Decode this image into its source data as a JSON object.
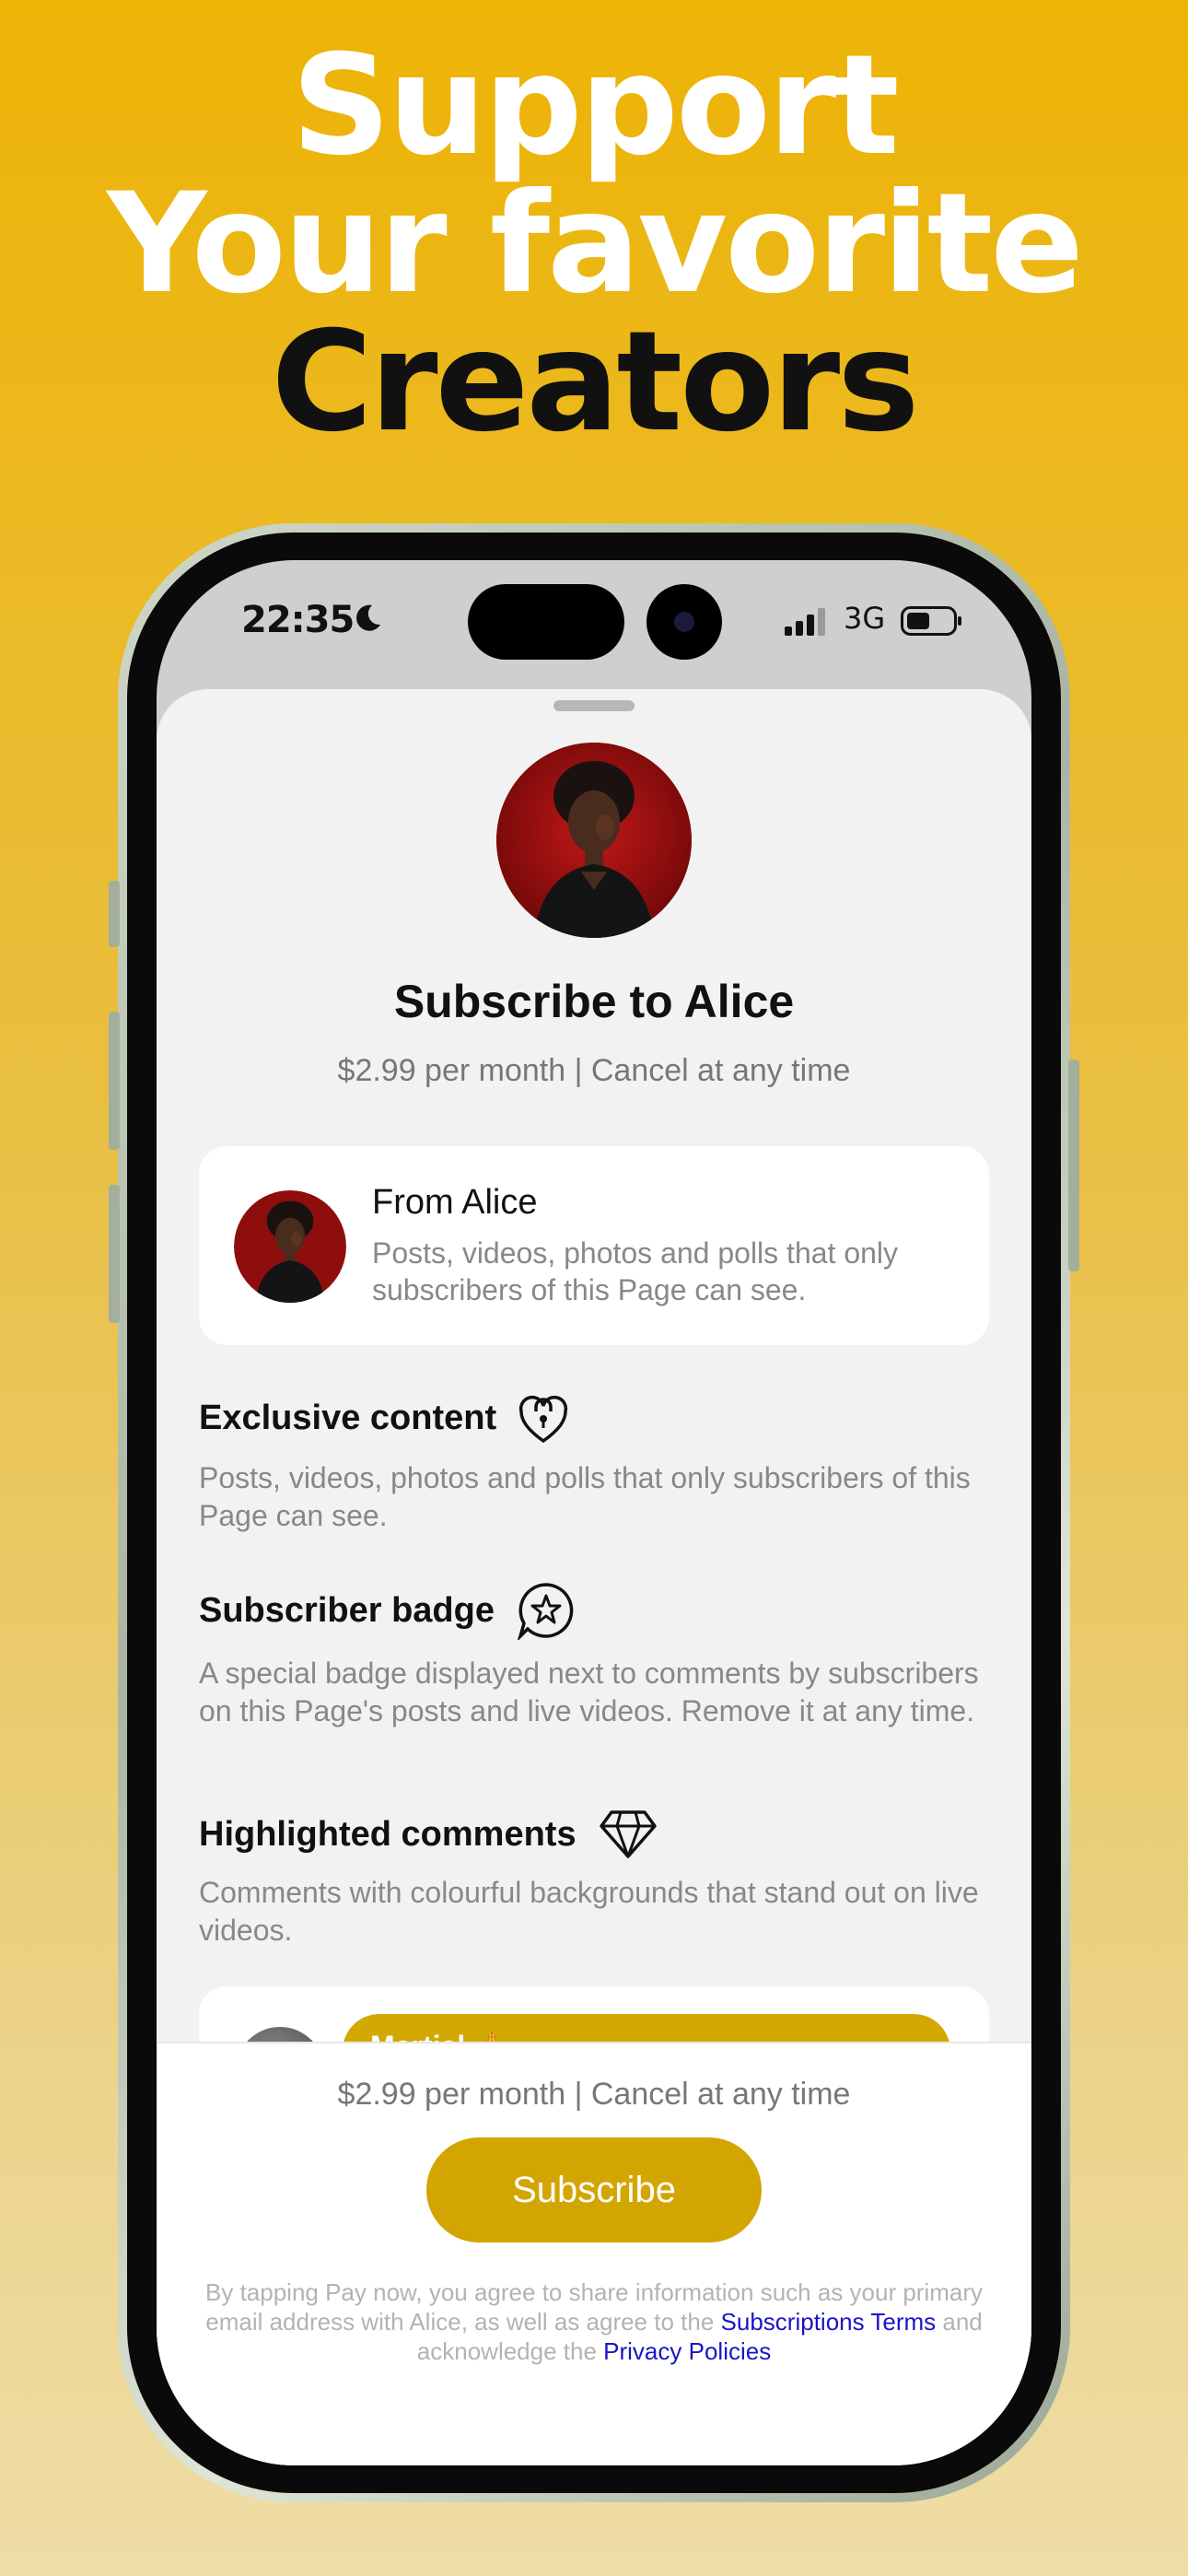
{
  "headline": {
    "line1": "Support",
    "line2": "Your favorite",
    "line3": "Creators"
  },
  "status_bar": {
    "time": "22:35",
    "network": "3G",
    "icons": [
      "moon-icon",
      "signal-icon",
      "battery-icon"
    ]
  },
  "sheet": {
    "title": "Subscribe to Alice",
    "subtitle": "$2.99 per month | Cancel at any time",
    "from_card": {
      "title": "From Alice",
      "description": "Posts, videos, photos and polls that only subscribers of this Page can see."
    },
    "features": [
      {
        "title": "Exclusive content",
        "icon": "lock-heart-icon",
        "description": "Posts, videos, photos and polls that only subscribers of this Page can see."
      },
      {
        "title": "Subscriber badge",
        "icon": "star-badge-icon",
        "description": "A special badge displayed next to comments by subscribers on this Page's posts and live videos. Remove it at any time."
      },
      {
        "title": "Highlighted comments",
        "icon": "diamond-icon",
        "description": "Comments with colourful backgrounds that stand out on live videos."
      }
    ],
    "preview_comment": {
      "name": "Martial 🙏"
    }
  },
  "footer": {
    "price": "$2.99 per month | Cancel at any time",
    "subscribe_label": "Subscribe",
    "terms_prefix": "By tapping Pay now, you agree to share information such as your primary email address with Alice, as well as agree to the",
    "terms_link": "Subscriptions Terms",
    "terms_middle": "and acknowledge the",
    "privacy_link": "Privacy Policies"
  },
  "colors": {
    "accent": "#D3A500",
    "link": "#1B14C9",
    "background_top": "#EDB305"
  }
}
